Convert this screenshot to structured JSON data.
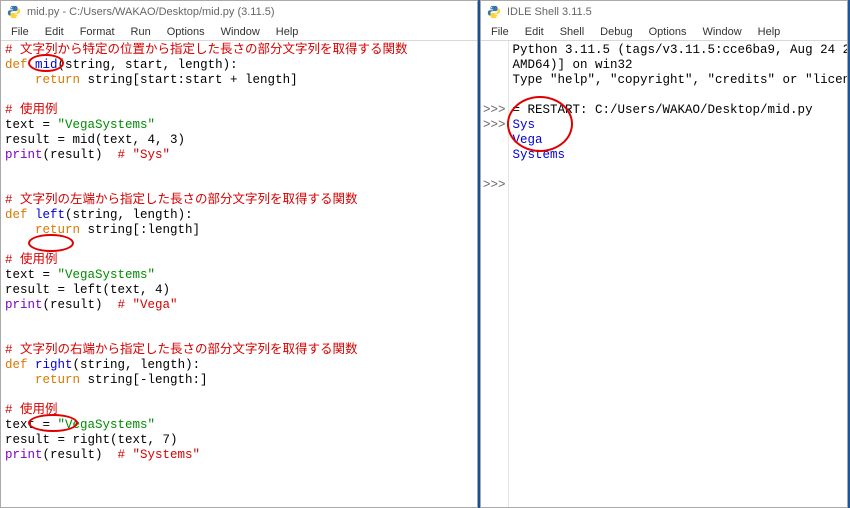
{
  "editor_window": {
    "title": "mid.py - C:/Users/WAKAO/Desktop/mid.py (3.11.5)",
    "menu": {
      "file": "File",
      "edit": "Edit",
      "format": "Format",
      "run": "Run",
      "options": "Options",
      "window": "Window",
      "help": "Help"
    }
  },
  "shell_window": {
    "title": "IDLE Shell 3.11.5",
    "menu": {
      "file": "File",
      "edit": "Edit",
      "shell": "Shell",
      "debug": "Debug",
      "options": "Options",
      "window": "Window",
      "help": "Help"
    }
  },
  "src": {
    "c_mid": "# 文字列から特定の位置から指定した長さの部分文字列を取得する関数",
    "kw_def": "def",
    "fn_mid": "mid",
    "sig_mid": "(string, start, length):",
    "kw_return": "return",
    "body_mid": " string[start:start + length]",
    "c_use": "# 使用例",
    "assign_text": "text = ",
    "lit_vega": "\"VegaSystems\"",
    "call_mid": "result = mid(text, 4, 3)",
    "print_pre": "print",
    "print_arg": "(result)  ",
    "out_sys_c1": "# ",
    "out_sys_c2": "\"Sys\"",
    "c_left": "# 文字列の左端から指定した長さの部分文字列を取得する関数",
    "fn_left": "left",
    "sig_left": "(string, length):",
    "body_left": " string[:length]",
    "call_left": "result = left(text, 4)",
    "out_vega_c1": "# ",
    "out_vega_c2": "\"Vega\"",
    "c_right": "# 文字列の右端から指定した長さの部分文字列を取得する関数",
    "fn_right": "right",
    "sig_right": "(string, length):",
    "body_right": " string[-length:]",
    "call_right": "result = right(text, 7)",
    "out_sys2_c1": "# ",
    "out_sys2_c2": "\"Systems\""
  },
  "shell": {
    "banner_l1": "Python 3.11.5 (tags/v3.11.5:cce6ba9, Aug 24 2",
    "banner_l2": "AMD64)] on win32",
    "banner_l3": "Type \"help\", \"copyright\", \"credits\" or \"licen",
    "prompt": ">>>",
    "restart": "= RESTART: C:/Users/WAKAO/Desktop/mid.py ",
    "out_1": "Sys",
    "out_2": "Vega",
    "out_3": "Systems"
  }
}
